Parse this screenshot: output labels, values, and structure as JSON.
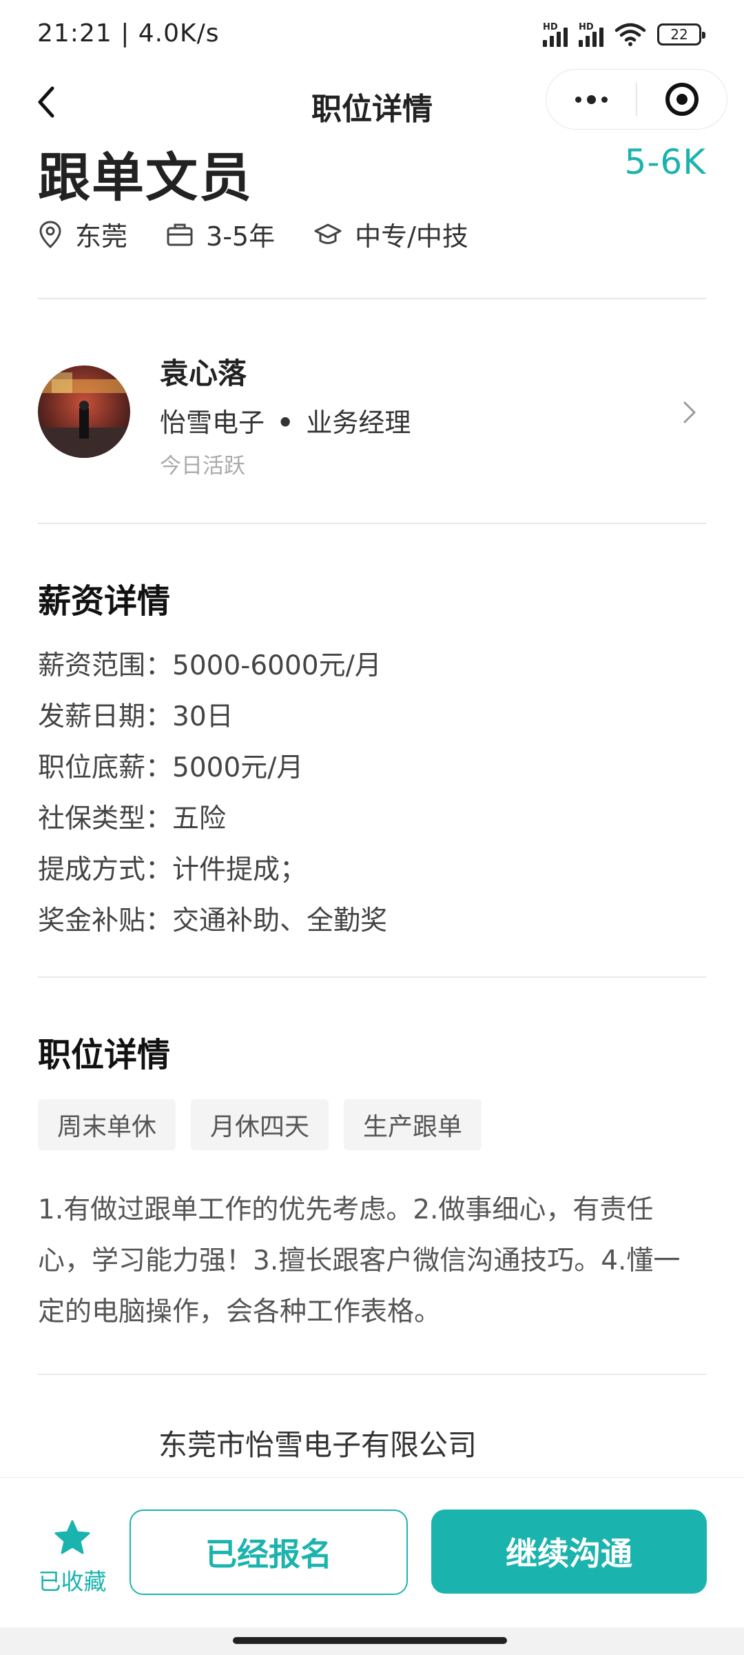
{
  "status_bar": {
    "time": "21:21 | 4.0K/s",
    "battery": "22",
    "signal_label": "HD"
  },
  "nav": {
    "title": "职位详情"
  },
  "job": {
    "title": "跟单文员",
    "salary": "5-6K",
    "location": "东莞",
    "experience": "3-5年",
    "education": "中专/中技"
  },
  "recruiter": {
    "name": "袁心落",
    "company": "怡雪电子",
    "separator": "•",
    "role": "业务经理",
    "activity": "今日活跃"
  },
  "salary_detail": {
    "title": "薪资详情",
    "rows": [
      "薪资范围：5000-6000元/月",
      "发薪日期：30日",
      "职位底薪：5000元/月",
      "社保类型：五险",
      "提成方式：计件提成；",
      "奖金补贴：交通补助、全勤奖"
    ]
  },
  "job_detail": {
    "title": "职位详情",
    "tags": [
      "周末单休",
      "月休四天",
      "生产跟单"
    ],
    "description": "1.有做过跟单工作的优先考虑。2.做事细心，有责任心，学习能力强！3.擅长跟客户微信沟通技巧。4.懂一定的电脑操作，会各种工作表格。"
  },
  "company": {
    "name": "东莞市怡雪电子有限公司"
  },
  "bottom_bar": {
    "favorite_label": "已收藏",
    "applied_label": "已经报名",
    "chat_label": "继续沟通"
  },
  "colors": {
    "accent": "#1bb3ae",
    "text": "#222222",
    "muted": "#aaaaaa"
  }
}
